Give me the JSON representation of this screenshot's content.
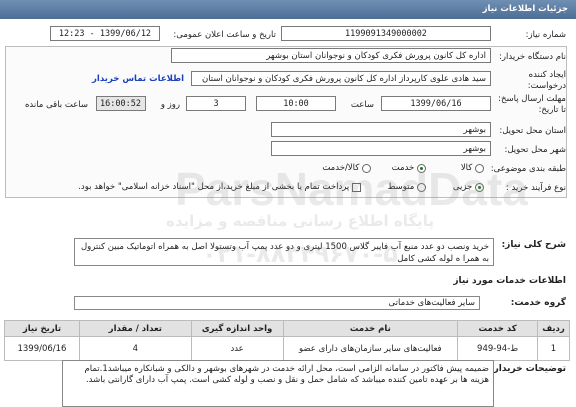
{
  "header": {
    "title": "جزئیات اطلاعات نیاز"
  },
  "form": {
    "need_number_label": "شماره نیاز:",
    "need_number": "1199091349000002",
    "announce_label": "تاریخ و ساعت اعلان عمومی:",
    "announce_value": "1399/06/12 - 12:23",
    "buyer_label": "نام دستگاه خریدار:",
    "buyer_value": "اداره کل کانون پرورش فکری کودکان و نوجوانان استان بوشهر",
    "creator_label_1": "ایجاد کننده",
    "creator_label_2": "درخواست:",
    "creator_value": "سید هادی علوی کارپرداز اداره کل کانون پرورش فکری کودکان و نوجوانان استان",
    "contact_link": "اطلاعات تماس خریدار",
    "deadline_label_1": "مهلت ارسال پاسخ:",
    "deadline_label_2": "تا تاریخ:",
    "deadline_date": "1399/06/16",
    "hour_label": "ساعت",
    "deadline_time": "10:00",
    "days": "3",
    "days_label": "روز و",
    "remaining_time": "16:00:52",
    "remaining_label": "ساعت باقی مانده",
    "province_label": "استان محل تحویل:",
    "province_value": "بوشهر",
    "city_label": "شهر محل تحویل:",
    "city_value": "بوشهر",
    "category_label": "طبقه بندی موضوعی:",
    "category_options": [
      "کالا",
      "خدمت",
      "کالا/خدمت"
    ],
    "process_label": "نوع فرآیند خرید :",
    "process_options": [
      "جزیی",
      "متوسط"
    ],
    "payment_note": "پرداخت تمام یا بخشی از مبلغ خرید،از محل \"اسناد خزانه اسلامی\" خواهد بود."
  },
  "description": {
    "label": "شرح کلی نیاز:",
    "text": "خرید ونصب دو عدد منبع آب فایبر گلاس 1500 لیتری و دو عدد پمپ آب وتستولا اصل به همراه اتوماتیک مبین کنترول به همرا ه لوله کشی کامل"
  },
  "services": {
    "section_title": "اطلاعات خدمات مورد نیاز",
    "group_label": "گروه خدمت:",
    "group_value": "سایر فعالیت‌های خدماتی",
    "columns": [
      "ردیف",
      "کد خدمت",
      "نام خدمت",
      "واحد اندازه گیری",
      "تعداد / مقدار",
      "تاریخ نیاز"
    ],
    "rows": [
      {
        "row": "1",
        "code": "ط-94-949",
        "name": "فعالیت‌های سایر سازمان‌های دارای عضو",
        "unit": "عدد",
        "qty": "4",
        "date": "1399/06/16"
      }
    ]
  },
  "notes": {
    "label": "توضیحات خریدار:",
    "text": "ضمیمه پیش فاکتور در سامانه الزامی است، محل ارائه خدمت در شهرهای بوشهر و دالکی و شبانکاره میباشد1.تمام هزینه ها بر عهده تامین کننده میباشد که شامل حمل و نقل و نصب و لوله کشی است. پمپ آب دارای گارانتی باشد."
  },
  "watermark": {
    "line1": "ParsNamadData",
    "line2": "پایگاه اطلاع رسانی مناقصه و مزایده",
    "line3": "۰۲۱-۸۸۳۴۹۶۷۰-۵"
  }
}
